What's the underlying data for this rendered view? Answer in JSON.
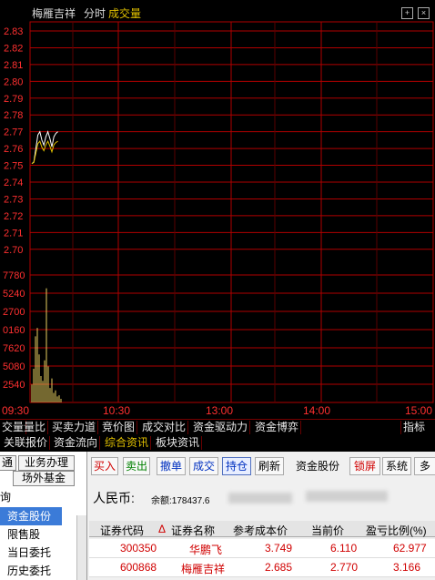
{
  "chart": {
    "stock_name": "梅雁吉祥",
    "period": "分时",
    "indicator": "成交量",
    "price_labels": [
      "2.83",
      "2.82",
      "2.81",
      "2.80",
      "2.79",
      "2.78",
      "2.77",
      "2.76",
      "2.75",
      "2.74",
      "2.73",
      "2.72",
      "2.71",
      "2.70"
    ],
    "volume_labels": [
      "7780",
      "5240",
      "2700",
      "0160",
      "7620",
      "5080",
      "2540"
    ],
    "time_labels": [
      "09:30",
      "10:30",
      "13:00",
      "14:00",
      "15:00"
    ],
    "icons": [
      "add-panel-icon",
      "close-panel-icon"
    ],
    "price_line": [
      2.751,
      2.752,
      2.76,
      2.768,
      2.77,
      2.765,
      2.762,
      2.767,
      2.77,
      2.766,
      2.761,
      2.767,
      2.769,
      2.77
    ],
    "volume_bars": [
      0.15,
      0.28,
      0.55,
      0.62,
      0.4,
      0.22,
      0.18,
      0.35,
      0.95,
      0.3,
      0.12,
      0.2,
      0.08,
      0.1,
      0.05,
      0.06,
      0.03
    ]
  },
  "tabs_row1": [
    "交量",
    "量比",
    "买卖力道",
    "竞价图",
    "成交对比",
    "资金驱动力",
    "资金博弈",
    "指标"
  ],
  "tabs_row2": [
    "关联报价",
    "资金流向",
    "综合资讯",
    "板块资讯"
  ],
  "left_panel": {
    "buttons": [
      "通",
      "业务办理",
      "场外基金"
    ],
    "section": "询",
    "items": [
      "资金股份",
      "限售股",
      "当日委托",
      "历史委托"
    ]
  },
  "toolbar": {
    "buttons": [
      "买入",
      "卖出",
      "撤单",
      "成交",
      "持仓",
      "刷新",
      "资金股份",
      "锁屏",
      "系统",
      "多"
    ]
  },
  "account": {
    "currency_label": "人民币:",
    "balance_label": "余额:178437.6"
  },
  "holdings": {
    "columns": [
      "证券代码",
      "证券名称",
      "参考成本价",
      "当前价",
      "盈亏比例(%)"
    ],
    "rows": [
      [
        "300350",
        "华鹏飞",
        "3.749",
        "6.110",
        "62.977"
      ],
      [
        "600868",
        "梅雁吉祥",
        "2.685",
        "2.770",
        "3.166"
      ]
    ]
  },
  "colors": {
    "grid_red": "#b00000",
    "price_axis": "#ff3030",
    "volume_yellow": "#e8d060",
    "price_line": "#ffffff",
    "indicator_yellow": "#e0c000"
  }
}
